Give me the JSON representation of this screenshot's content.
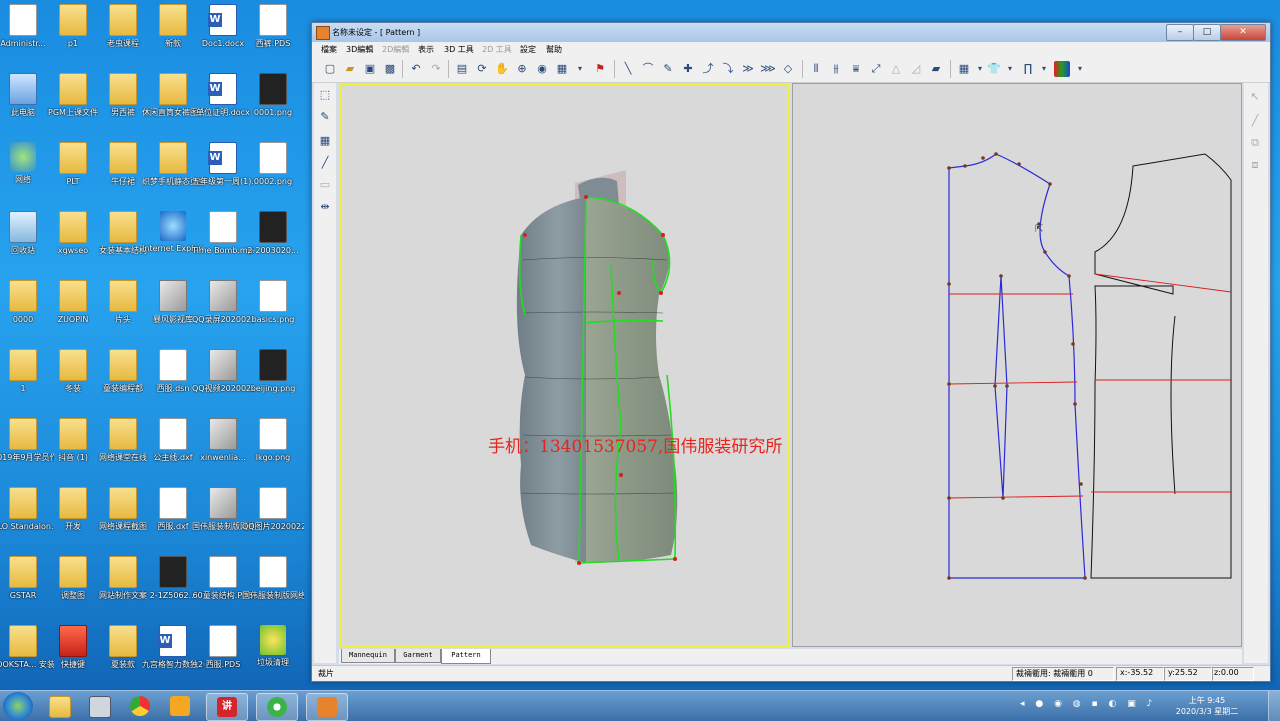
{
  "desktop": {
    "icons": [
      {
        "label": "Administr...",
        "kind": "doc"
      },
      {
        "label": "p1",
        "kind": "folder"
      },
      {
        "label": "老虫课程",
        "kind": "folder"
      },
      {
        "label": "新款",
        "kind": "folder"
      },
      {
        "label": "Doc1.docx",
        "kind": "word"
      },
      {
        "label": "西裤.PDS",
        "kind": "doc"
      },
      {
        "label": "此电脑",
        "kind": "pc"
      },
      {
        "label": "PGM上课文件",
        "kind": "folder"
      },
      {
        "label": "男西裤",
        "kind": "folder"
      },
      {
        "label": "休闲直筒女裤图片",
        "kind": "folder"
      },
      {
        "label": "单位证明.docx",
        "kind": "word"
      },
      {
        "label": "0001.png",
        "kind": "dark"
      },
      {
        "label": "网络",
        "kind": "globe"
      },
      {
        "label": "PLT",
        "kind": "folder"
      },
      {
        "label": "牛仔裙",
        "kind": "folder"
      },
      {
        "label": "织梦手机静态页生成插件...",
        "kind": "folder"
      },
      {
        "label": "五年级第一周(1).docx",
        "kind": "word"
      },
      {
        "label": "0002.png",
        "kind": "doc"
      },
      {
        "label": "回收站",
        "kind": "bin"
      },
      {
        "label": "xgwseo",
        "kind": "folder"
      },
      {
        "label": "女装基本结构",
        "kind": "folder"
      },
      {
        "label": "Internet Explorer",
        "kind": "ie"
      },
      {
        "label": "Time Bomb.mp3",
        "kind": "doc"
      },
      {
        "label": "2-2003020...",
        "kind": "dark"
      },
      {
        "label": "0000",
        "kind": "folder"
      },
      {
        "label": "ZUOPIN",
        "kind": "folder"
      },
      {
        "label": "片头",
        "kind": "folder"
      },
      {
        "label": "暴风影视库",
        "kind": "img"
      },
      {
        "label": "QQ录屏20200228...",
        "kind": "img"
      },
      {
        "label": "basics.png",
        "kind": "doc"
      },
      {
        "label": "1",
        "kind": "folder"
      },
      {
        "label": "冬装",
        "kind": "folder"
      },
      {
        "label": "童装编程都",
        "kind": "folder"
      },
      {
        "label": "西服.dsn",
        "kind": "doc"
      },
      {
        "label": "QQ视频20200225...",
        "kind": "img"
      },
      {
        "label": "beijing.png",
        "kind": "dark"
      },
      {
        "label": "2019年9月学员作品",
        "kind": "folder"
      },
      {
        "label": "抖音 (1)",
        "kind": "folder"
      },
      {
        "label": "网络课堂在线",
        "kind": "folder"
      },
      {
        "label": "公主线.dxf",
        "kind": "doc"
      },
      {
        "label": "xinwenlia...",
        "kind": "img"
      },
      {
        "label": "lkgo.png",
        "kind": "doc"
      },
      {
        "label": "CLO Standalon...",
        "kind": "folder"
      },
      {
        "label": "开发",
        "kind": "folder"
      },
      {
        "label": "网络课程截图",
        "kind": "folder"
      },
      {
        "label": "西服.dxf",
        "kind": "doc"
      },
      {
        "label": "国伟服装制版网络授课...",
        "kind": "img"
      },
      {
        "label": "QQ图片2020022...",
        "kind": "doc"
      },
      {
        "label": "GSTAR",
        "kind": "folder"
      },
      {
        "label": "调整图",
        "kind": "folder"
      },
      {
        "label": "网站制作文案",
        "kind": "folder"
      },
      {
        "label": "2-1Z5062...",
        "kind": "dark"
      },
      {
        "label": "60童装结构.PDS",
        "kind": "doc"
      },
      {
        "label": "国伟服装制版网络教学培...",
        "kind": "doc"
      },
      {
        "label": "LOOKSTA... 安装版本",
        "kind": "folder"
      },
      {
        "label": "快捷键",
        "kind": "red"
      },
      {
        "label": "夏装款",
        "kind": "folder"
      },
      {
        "label": "九宫格智力数独200题(题...",
        "kind": "word"
      },
      {
        "label": "西服.PDS",
        "kind": "doc"
      },
      {
        "label": "垃圾清理",
        "kind": "green"
      }
    ]
  },
  "window": {
    "title": "名称未设定 - [ Pattern ]",
    "minimize": "–",
    "maximize": "□",
    "close": "✕"
  },
  "menu": [
    {
      "label": "檔案",
      "enabled": true
    },
    {
      "label": "3D編輯",
      "enabled": true
    },
    {
      "label": "2D編輯",
      "enabled": false
    },
    {
      "label": "表示",
      "enabled": true
    },
    {
      "label": "3D 工具",
      "enabled": true
    },
    {
      "label": "2D 工具",
      "enabled": false
    },
    {
      "label": "設定",
      "enabled": true
    },
    {
      "label": "幫助",
      "enabled": true
    }
  ],
  "toolbar_icons": [
    "new-icon",
    "open-icon",
    "save-icon",
    "save-as-icon",
    "undo-icon",
    "redo-icon",
    "grid-icon",
    "rotate-icon",
    "pan-icon",
    "zoom-icon",
    "camera-icon",
    "view-icon",
    "flag-icon",
    "line-icon",
    "curve-icon",
    "pen-icon",
    "point-icon",
    "arc-icon",
    "arc2-icon",
    "dart-icon",
    "dart2-icon",
    "eraser-icon",
    "measure-icon",
    "measure2-icon",
    "align-icon",
    "fit-icon",
    "shape-icon",
    "shape2-icon",
    "ruler-icon",
    "palette-icon",
    "shirt-icon",
    "pants-icon",
    "color-icon"
  ],
  "tabs": [
    {
      "label": "Mannequin",
      "active": false
    },
    {
      "label": "Garment",
      "active": false
    },
    {
      "label": "Pattern",
      "active": true
    }
  ],
  "status": {
    "left": "裁片",
    "mode": "裁裲衢用: 裁裲衢用 0",
    "x": "x:-35.52",
    "y": "y:25.52",
    "z": "z:0.00"
  },
  "watermark": "手机：13401537057,国伟服装研究所",
  "taskbar": {
    "apps": [
      "explorer-icon",
      "calculator-icon",
      "chrome-icon",
      "folder-app-icon",
      "wps-icon",
      "tencent-icon",
      "app-orange-icon"
    ],
    "clock_time": "上午 9:45",
    "clock_date": "2020/3/3 星期二"
  }
}
